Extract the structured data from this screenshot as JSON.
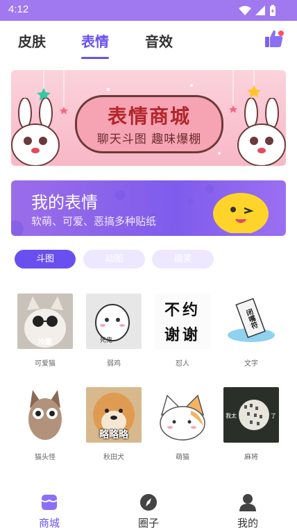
{
  "status": {
    "time": "4:12"
  },
  "tabs": [
    {
      "label": "皮肤"
    },
    {
      "label": "表情"
    },
    {
      "label": "音效"
    }
  ],
  "banner": {
    "title": "表情商城",
    "subtitle": "聊天斗图 趣味爆棚"
  },
  "my_card": {
    "title": "我的表情",
    "subtitle": "软萌、可爱、恶搞多种贴纸"
  },
  "chips": [
    {
      "label": "斗图",
      "active": true
    },
    {
      "label": "动图",
      "active": false
    },
    {
      "label": "搞笑",
      "active": false
    }
  ],
  "stickers": [
    {
      "label": "可爱猫",
      "caption": "冷酷"
    },
    {
      "label": "弱鸡",
      "caption": "死鬼"
    },
    {
      "label": "怼人",
      "line1": "不约",
      "line2": "谢谢"
    },
    {
      "label": "文字",
      "caption": "闭嘴符"
    },
    {
      "label": "猫头怪"
    },
    {
      "label": "秋田犬",
      "caption": "略略略"
    },
    {
      "label": "萌猫"
    },
    {
      "label": "麻将",
      "left": "我太",
      "right": "了"
    }
  ],
  "nav": [
    {
      "label": "商城",
      "icon": "shop-icon",
      "active": true
    },
    {
      "label": "圈子",
      "icon": "compass-icon",
      "active": false
    },
    {
      "label": "我的",
      "icon": "user-icon",
      "active": false
    }
  ],
  "colors": {
    "accent": "#6a4ff0",
    "status_bar": "#a078ef",
    "chip_inactive": "#ede8ff"
  }
}
